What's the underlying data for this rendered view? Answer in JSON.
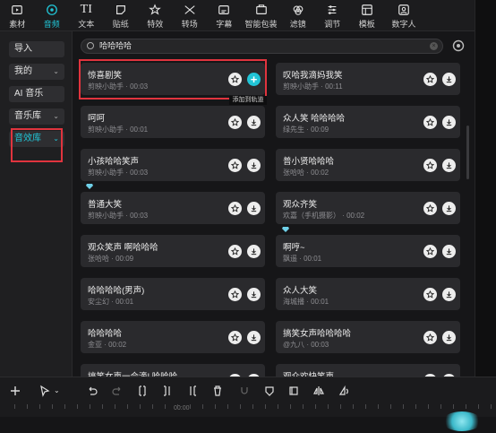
{
  "top_tabs": [
    {
      "label": "素材",
      "icon": "media-icon"
    },
    {
      "label": "音频",
      "icon": "audio-icon",
      "active": true
    },
    {
      "label": "文本",
      "icon": "text-icon"
    },
    {
      "label": "贴纸",
      "icon": "sticker-icon"
    },
    {
      "label": "特效",
      "icon": "effects-icon"
    },
    {
      "label": "转场",
      "icon": "transition-icon"
    },
    {
      "label": "字幕",
      "icon": "subtitle-icon"
    },
    {
      "label": "智能包装",
      "icon": "smart-package-icon"
    },
    {
      "label": "滤镜",
      "icon": "filter-icon"
    },
    {
      "label": "调节",
      "icon": "adjust-icon"
    },
    {
      "label": "模板",
      "icon": "template-icon"
    },
    {
      "label": "数字人",
      "icon": "digital-human-icon"
    }
  ],
  "sidebar": {
    "items": [
      {
        "label": "导入",
        "chevron": ""
      },
      {
        "label": "我的",
        "chevron": "⌄"
      },
      {
        "label": "AI 音乐",
        "chevron": ""
      },
      {
        "label": "音乐库",
        "chevron": "⌄"
      },
      {
        "label": "音效库",
        "chevron": "⌄",
        "active": true
      }
    ]
  },
  "search": {
    "value": "哈哈哈哈"
  },
  "tooltip": "添加到轨道",
  "cards": [
    {
      "title": "惊喜剧笑",
      "sub": "剪映小助手 · 00:03"
    },
    {
      "title": "叹哈我滴妈我笑",
      "sub": "剪映小助手 · 00:11"
    },
    {
      "title": "呵呵",
      "sub": "剪映小助手 · 00:01"
    },
    {
      "title": "众人笑 哈哈哈哈",
      "sub": "绿先生 · 00:09"
    },
    {
      "title": "小孩哈哈笑声",
      "sub": "剪映小助手 · 00:03"
    },
    {
      "title": "普小贤哈哈哈",
      "sub": "张哈哈 · 00:02"
    },
    {
      "title": "普通大笑",
      "sub": "剪映小助手 · 00:03"
    },
    {
      "title": "观众齐笑",
      "sub": "欢嘉（手机摄影） · 00:02"
    },
    {
      "title": "观众笑声 啊哈哈哈",
      "sub": "张哈哈 · 00:09"
    },
    {
      "title": "啊哼~",
      "sub": "飘遥 · 00:01"
    },
    {
      "title": "哈哈哈哈(男声)",
      "sub": "安尘幻 · 00:01"
    },
    {
      "title": "众人大笑",
      "sub": "海城播 · 00:01"
    },
    {
      "title": "哈哈哈哈",
      "sub": "金亚 · 00:02"
    },
    {
      "title": "搞笑女声哈哈哈哈",
      "sub": "@九八 · 00:03"
    },
    {
      "title": "搞笑女声一会滴! 哈哈哈",
      "sub": ""
    },
    {
      "title": "观众欢快笑声",
      "sub": ""
    }
  ],
  "bottom_tools": [
    "add-icon",
    "select-cursor-icon",
    "undo-icon",
    "redo-icon",
    "split-icon",
    "split-left-icon",
    "split-right-icon",
    "delete-icon",
    "freeze-icon",
    "mark-icon",
    "crop-icon",
    "mirror-icon",
    "rotate-icon"
  ],
  "ruler": {
    "label": "00:00"
  },
  "colors": {
    "accent": "#21c4d6",
    "highlight_box": "#e0343e"
  }
}
